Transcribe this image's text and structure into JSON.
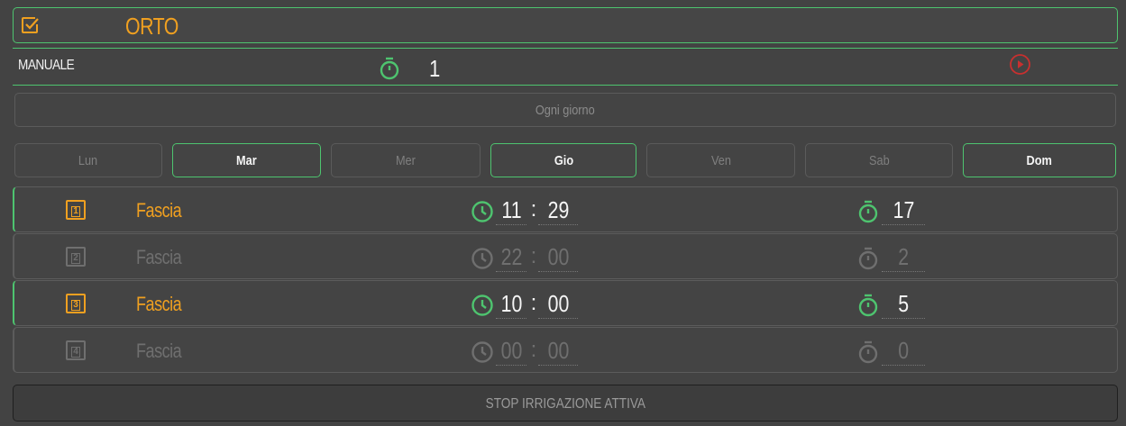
{
  "header": {
    "title": "ORTO",
    "checkbox_checked": true
  },
  "manual": {
    "label": "MANUALE",
    "value": "1"
  },
  "daily_button": "Ogni giorno",
  "days": [
    {
      "label": "Lun",
      "active": false
    },
    {
      "label": "Mar",
      "active": true
    },
    {
      "label": "Mer",
      "active": false
    },
    {
      "label": "Gio",
      "active": true
    },
    {
      "label": "Ven",
      "active": false
    },
    {
      "label": "Sab",
      "active": false
    },
    {
      "label": "Dom",
      "active": true
    }
  ],
  "slots": [
    {
      "number": "1",
      "label": "Fascia",
      "hour": "11",
      "minute": "29",
      "duration": "17",
      "active": true
    },
    {
      "number": "2",
      "label": "Fascia",
      "hour": "22",
      "minute": "00",
      "duration": "2",
      "active": false
    },
    {
      "number": "3",
      "label": "Fascia",
      "hour": "10",
      "minute": "00",
      "duration": "5",
      "active": true
    },
    {
      "number": "4",
      "label": "Fascia",
      "hour": "00",
      "minute": "00",
      "duration": "0",
      "active": false
    }
  ],
  "colon": ":",
  "stop_button": "STOP IRRIGAZIONE ATTIVA",
  "colors": {
    "accent": "#f0a020",
    "green": "#4ec46f",
    "play": "#c8302f",
    "inactive": "#6f6f6f"
  }
}
